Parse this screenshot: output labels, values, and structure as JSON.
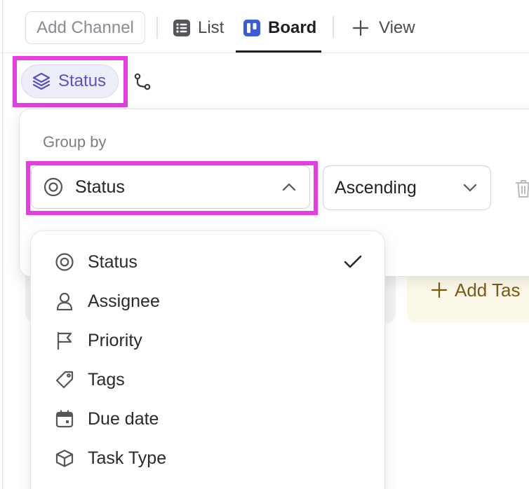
{
  "viewbar": {
    "add_channel": "Add Channel",
    "tabs": [
      {
        "label": "List",
        "icon": "list-icon"
      },
      {
        "label": "Board",
        "icon": "board-icon",
        "active": true
      },
      {
        "label": "View",
        "icon": "plus-icon"
      }
    ]
  },
  "filters": {
    "group_chip": "Status",
    "subgroup_icon": "subgroup-icon"
  },
  "popup": {
    "group_by_label": "Group by",
    "group_by_value": "Status",
    "order_value": "Ascending"
  },
  "menu": {
    "items": [
      {
        "label": "Status",
        "icon": "status-icon",
        "selected": true
      },
      {
        "label": "Assignee",
        "icon": "person-icon"
      },
      {
        "label": "Priority",
        "icon": "flag-icon"
      },
      {
        "label": "Tags",
        "icon": "tag-icon"
      },
      {
        "label": "Due date",
        "icon": "calendar-icon"
      },
      {
        "label": "Task Type",
        "icon": "cube-icon"
      }
    ]
  },
  "board": {
    "add_task": "Add Tas"
  },
  "colors": {
    "highlight": "#e53de0",
    "chip_text": "#5752c4",
    "chip_bg": "#eeeefb",
    "board_accent": "#3b5bdb",
    "add_task_text": "#7a5c16",
    "add_task_bg": "#fcf8ea"
  }
}
